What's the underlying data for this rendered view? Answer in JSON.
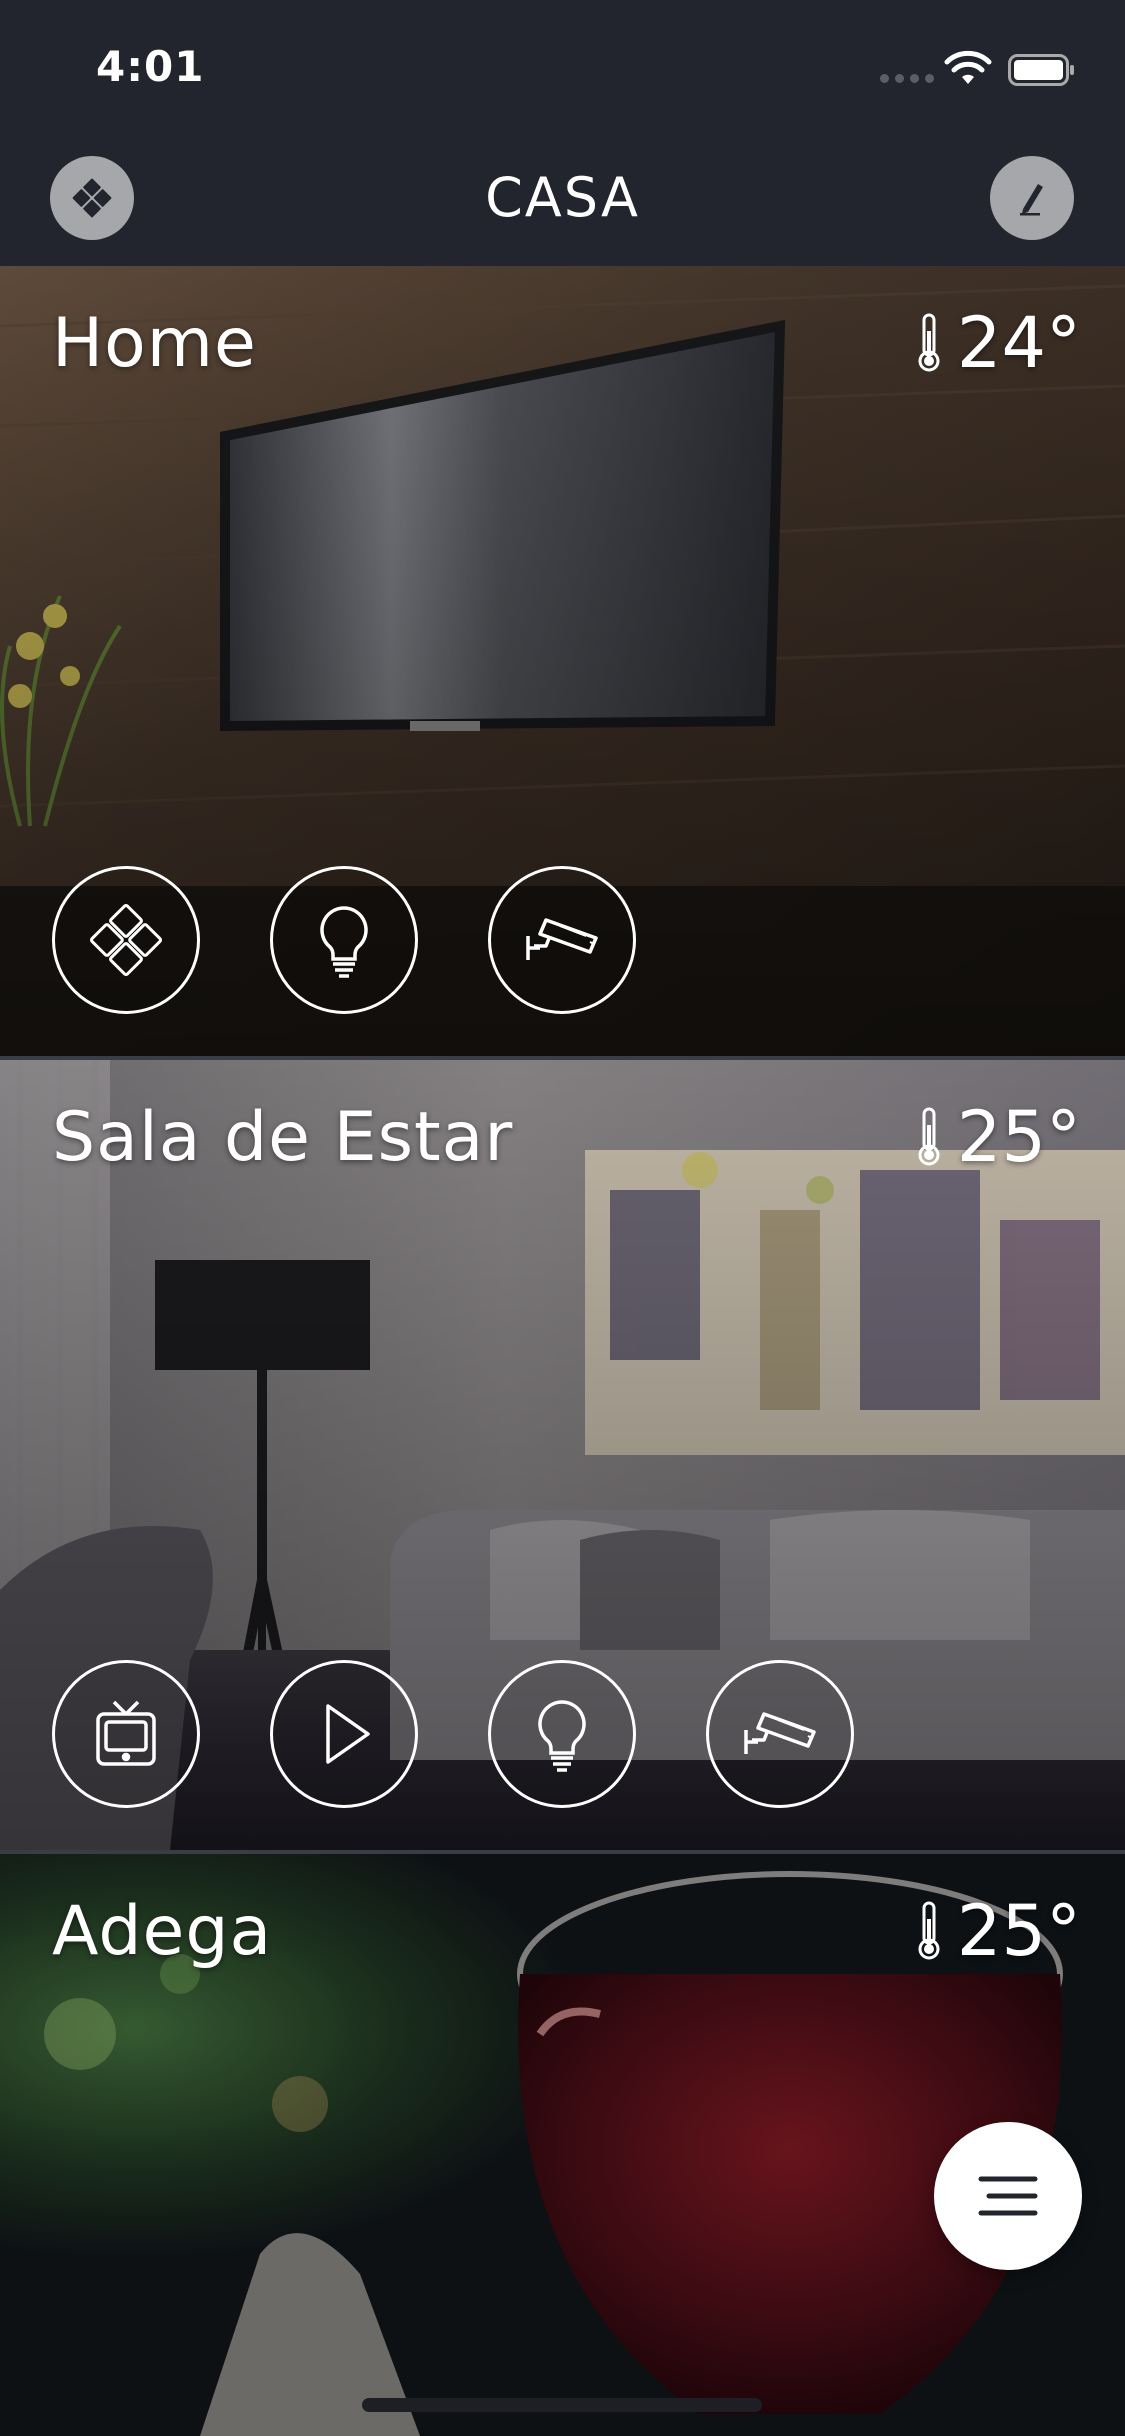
{
  "status_bar": {
    "time": "4:01",
    "icons": [
      "signal-dots-icon",
      "wifi-icon",
      "battery-icon"
    ]
  },
  "nav": {
    "title": "CASA",
    "left_button_icon": "diamond-grid-icon",
    "right_button_icon": "pencil-icon"
  },
  "rooms": [
    {
      "name": "Home",
      "temperature": "24°",
      "devices": [
        "diamond-grid-icon",
        "light-bulb-icon",
        "security-camera-icon"
      ]
    },
    {
      "name": "Sala de Estar",
      "temperature": "25°",
      "devices": [
        "tv-icon",
        "play-icon",
        "light-bulb-icon",
        "security-camera-icon"
      ]
    },
    {
      "name": "Adega",
      "temperature": "25°",
      "devices": []
    }
  ],
  "fab": {
    "icon": "menu-icon"
  },
  "colors": {
    "background": "#22252d",
    "nav_button": "#a6a7ab",
    "white": "#ffffff"
  }
}
